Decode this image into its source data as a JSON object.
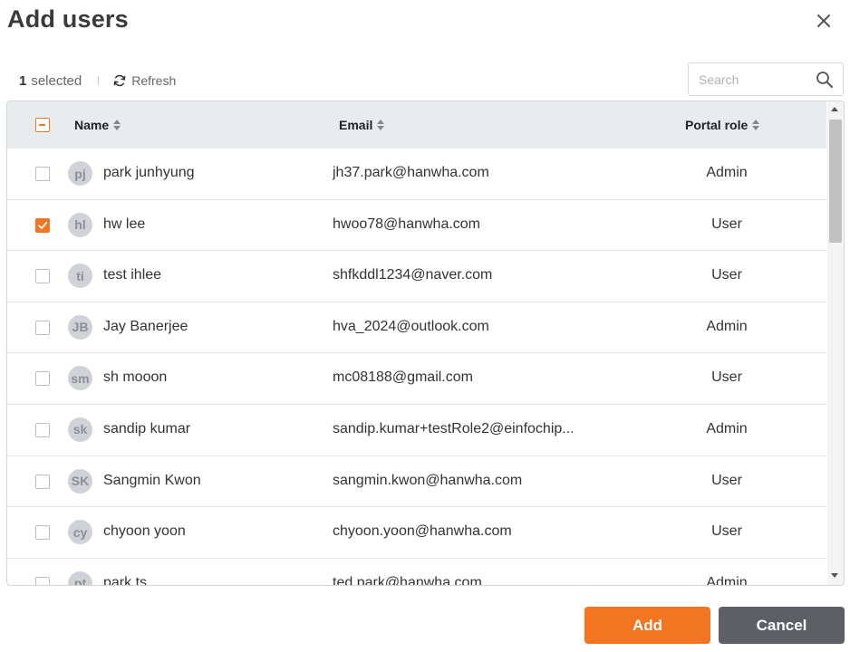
{
  "dialog": {
    "title": "Add users"
  },
  "toolbar": {
    "selected_count": "1",
    "selected_label": "selected",
    "refresh_label": "Refresh"
  },
  "search": {
    "placeholder": "Search",
    "value": ""
  },
  "table": {
    "columns": {
      "name": "Name",
      "email": "Email",
      "role": "Portal role"
    },
    "rows": [
      {
        "initials": "pj",
        "name": "park junhyung",
        "email": "jh37.park@hanwha.com",
        "role": "Admin",
        "checked": false
      },
      {
        "initials": "hl",
        "name": "hw lee",
        "email": "hwoo78@hanwha.com",
        "role": "User",
        "checked": true
      },
      {
        "initials": "ti",
        "name": "test ihlee",
        "email": "shfkddl1234@naver.com",
        "role": "User",
        "checked": false
      },
      {
        "initials": "JB",
        "name": "Jay Banerjee",
        "email": "hva_2024@outlook.com",
        "role": "Admin",
        "checked": false
      },
      {
        "initials": "sm",
        "name": "sh mooon",
        "email": "mc08188@gmail.com",
        "role": "User",
        "checked": false
      },
      {
        "initials": "sk",
        "name": "sandip kumar",
        "email": "sandip.kumar+testRole2@einfochip...",
        "role": "Admin",
        "checked": false
      },
      {
        "initials": "SK",
        "name": "Sangmin Kwon",
        "email": "sangmin.kwon@hanwha.com",
        "role": "User",
        "checked": false
      },
      {
        "initials": "cy",
        "name": "chyoon yoon",
        "email": "chyoon.yoon@hanwha.com",
        "role": "User",
        "checked": false
      },
      {
        "initials": "pt",
        "name": "park ts",
        "email": "ted.park@hanwha.com",
        "role": "Admin",
        "checked": false
      }
    ]
  },
  "footer": {
    "add_label": "Add",
    "cancel_label": "Cancel"
  },
  "colors": {
    "accent": "#f47521",
    "cancel": "#5c6066",
    "header_bg": "#e9ecef"
  }
}
